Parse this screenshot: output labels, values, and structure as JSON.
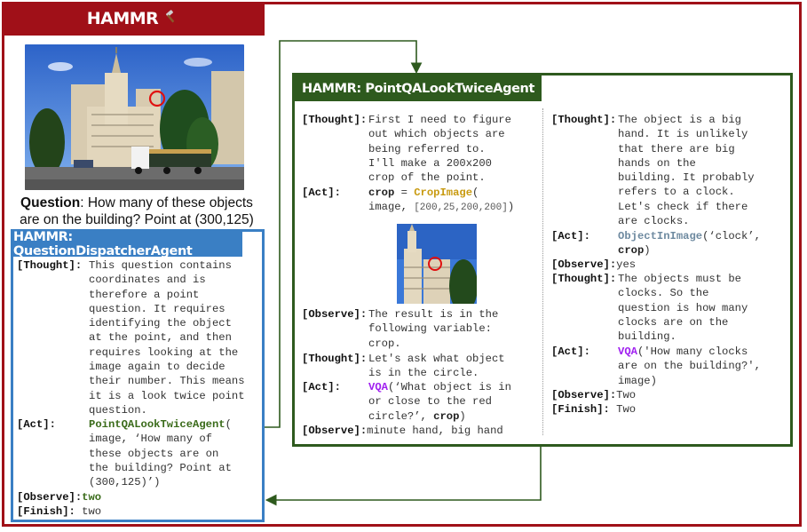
{
  "outer": {
    "title": "HAMMR",
    "icon": "hammer-icon"
  },
  "question": {
    "label": "Question",
    "text": ": How many of these objects are on the building? Point at (300,125)"
  },
  "qd_agent": {
    "title": "HAMMR: QuestionDispatcherAgent",
    "thought_label": "[Thought]:",
    "thought_lines": [
      "This question contains",
      "coordinates and is",
      "therefore a point",
      "question. It requires",
      "identifying the object",
      "at the point, and then",
      "requires looking at the",
      "image again to decide",
      "their number. This means",
      "it is a look twice point",
      "question."
    ],
    "act_label": "[Act]:",
    "act_agent": "PointQALookTwiceAgent",
    "act_paren": "(",
    "act_lines": [
      "image, ‘How many of",
      "these objects are on",
      "the building? Point at",
      "(300,125)’)"
    ],
    "observe_label": "[Observe]:",
    "observe_value": "two",
    "finish_label": "[Finish]:",
    "finish_value": " two"
  },
  "pq_agent": {
    "title": "HAMMR: PointQALookTwiceAgent",
    "left": {
      "thought1_label": "[Thought]:",
      "thought1_lines": [
        "First I need to figure",
        "out which objects are",
        "being referred to.",
        "I'll make a 200x200",
        "crop of the point."
      ],
      "act1_label": "[Act]:",
      "act1_var": "crop",
      "act1_eq": " = ",
      "act1_fn": "CropImage",
      "act1_paren": "(",
      "act1_args_prefix": "image, ",
      "act1_args": "[200,25,200,200]",
      "act1_close": ")",
      "observe1_label": "[Observe]:",
      "observe1_lines": [
        "The result is in the",
        "following variable:",
        "crop."
      ],
      "thought2_label": "[Thought]:",
      "thought2_lines": [
        "Let's ask what object",
        "is in the circle."
      ],
      "act2_label": "[Act]:",
      "act2_fn": "VQA",
      "act2_line1": "(‘What object is in",
      "act2_line2": "or close to the red",
      "act2_line3_a": "circle?’, ",
      "act2_line3_b": "crop",
      "act2_line3_c": ")",
      "observe2_label": "[Observe]:",
      "observe2_value": "minute hand, big hand"
    },
    "right": {
      "thought1_label": "[Thought]:",
      "thought1_lines": [
        "The object is a big",
        "hand. It is unlikely",
        "that there are big",
        "hands on the",
        "building. It probably",
        "refers to a clock.",
        "Let's check if there",
        "are clocks."
      ],
      "act1_label": "[Act]:",
      "act1_fn": "ObjectInImage",
      "act1_line1": "(‘clock’,",
      "act1_line2_a": "crop",
      "act1_line2_b": ")",
      "observe1_label": "[Observe]:",
      "observe1_value": "yes",
      "thought2_label": "[Thought]:",
      "thought2_lines": [
        "The objects must be",
        "clocks. So the",
        "question is how many",
        "clocks are on the",
        "building."
      ],
      "act2_label": "[Act]:",
      "act2_fn": "VQA",
      "act2_line1": "('How many clocks",
      "act2_line2": "are on the building?',",
      "act2_line3": "image)",
      "observe2_label": "[Observe]:",
      "observe2_value": "Two",
      "finish_label": "[Finish]:",
      "finish_value": " Two"
    }
  },
  "colors": {
    "hammr_red": "#a01018",
    "qd_blue": "#3a7fc4",
    "pq_green": "#2e5a1e",
    "agent_green": "#3a6b1a",
    "crop_gold": "#c89a10",
    "vqa_purple": "#a020f0",
    "object_slate": "#6e8aa0"
  }
}
